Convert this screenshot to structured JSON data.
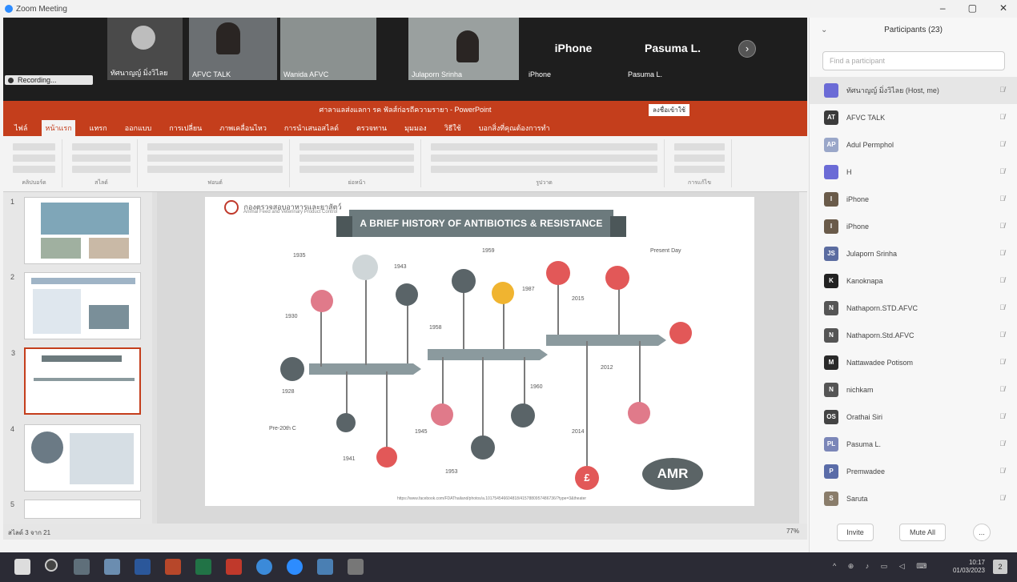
{
  "window": {
    "title": "Zoom Meeting"
  },
  "video_tiles": [
    {
      "name": "ทัศนาญญ์ มิ่งวิไลย"
    },
    {
      "name": "AFVC TALK"
    },
    {
      "name": "Wanida AFVC"
    },
    {
      "name": "Julaporn Srinha"
    },
    {
      "name": "iPhone",
      "big": "iPhone"
    },
    {
      "name": "Pasuma L.",
      "big": "Pasuma L."
    }
  ],
  "recording_label": "Recording...",
  "powerpoint": {
    "title": "ศาลาแลส่งแลกา รค ฟัลส์ก่อรถีความรายา - PowerPoint",
    "badge": "ลงชื่อเข้าใช้",
    "menu": [
      "ไฟล์",
      "หน้าแรก",
      "แทรก",
      "ออกแบบ",
      "การเปลี่ยน",
      "ภาพเคลื่อนไหว",
      "การนำเสนอสไลด์",
      "ตรวจทาน",
      "มุมมอง",
      "วิธีใช้",
      "บอกสิ่งที่คุณต้องการทำ"
    ],
    "ribbon_groups": [
      "คลิปบอร์ด",
      "สไลด์",
      "ฟอนต์",
      "ย่อหน้า",
      "รูปวาด",
      "การแก้ไข"
    ],
    "slide_numbers": [
      "1",
      "2",
      "3",
      "4",
      "5"
    ],
    "status_left": "สไลด์ 3 จาก 21",
    "status_right": "77%",
    "slide": {
      "org": "กองตรวจสอบอาหารและยาสัตว์",
      "org_sub": "Animal Feed and Veterinary Product Control",
      "banner": "A BRIEF HISTORY OF ANTIBIOTICS & RESISTANCE",
      "logo": "AMR",
      "url": "https://www.facebook.com/FDAThailand/photos/a.101754546604818/4157880957486736/?type=3&theater",
      "events": [
        {
          "year": "Pre-20th C"
        },
        {
          "year": "1928"
        },
        {
          "year": "1930"
        },
        {
          "year": "1935"
        },
        {
          "year": "1941"
        },
        {
          "year": "1943"
        },
        {
          "year": "1945"
        },
        {
          "year": "1953"
        },
        {
          "year": "1958"
        },
        {
          "year": "1959"
        },
        {
          "year": "1960"
        },
        {
          "year": "1987"
        },
        {
          "year": "2012"
        },
        {
          "year": "2014"
        },
        {
          "year": "2015"
        },
        {
          "year": "Present Day"
        }
      ]
    }
  },
  "participants": {
    "header": "Participants (23)",
    "search_placeholder": "Find a participant",
    "list": [
      {
        "initials": "",
        "name": "ทัศนาญญ์ มิ่งวิไลย (Host, me)",
        "color": "#6b6bd6"
      },
      {
        "initials": "AT",
        "name": "AFVC TALK",
        "color": "#3b3b3b"
      },
      {
        "initials": "AP",
        "name": "Adul Permphol",
        "color": "#9aa7c9"
      },
      {
        "initials": "",
        "name": "H",
        "color": "#6b6bd6"
      },
      {
        "initials": "I",
        "name": "iPhone",
        "color": "#6a5b4a"
      },
      {
        "initials": "I",
        "name": "iPhone",
        "color": "#6a5b4a"
      },
      {
        "initials": "JS",
        "name": "Julaporn Srinha",
        "color": "#5b6ca0"
      },
      {
        "initials": "K",
        "name": "Kanoknapa",
        "color": "#222222"
      },
      {
        "initials": "N",
        "name": "Nathaporn.STD.AFVC",
        "color": "#555555"
      },
      {
        "initials": "N",
        "name": "Nathaporn.Std.AFVC",
        "color": "#555555"
      },
      {
        "initials": "M",
        "name": "Nattawadee Potisom",
        "color": "#2a2a2a"
      },
      {
        "initials": "N",
        "name": "nichkam",
        "color": "#555555"
      },
      {
        "initials": "OS",
        "name": "Orathai Siri",
        "color": "#444444"
      },
      {
        "initials": "PL",
        "name": "Pasuma L.",
        "color": "#7b86b8"
      },
      {
        "initials": "P",
        "name": "Premwadee",
        "color": "#5a6ca8"
      },
      {
        "initials": "S",
        "name": "Saruta",
        "color": "#8a7d6b"
      }
    ],
    "invite_label": "Invite",
    "mute_all_label": "Mute All",
    "more_label": "..."
  },
  "taskbar": {
    "time": "10:17",
    "date": "01/03/2023"
  }
}
